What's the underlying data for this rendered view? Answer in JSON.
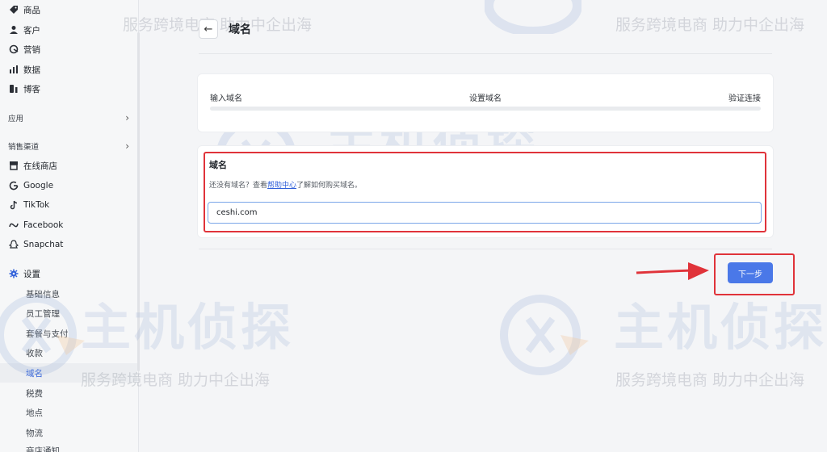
{
  "sidebar": {
    "items": [
      {
        "label": "商品",
        "icon": "tag-icon"
      },
      {
        "label": "客户",
        "icon": "user-icon"
      },
      {
        "label": "营销",
        "icon": "marketing-icon"
      },
      {
        "label": "数据",
        "icon": "bar-chart-icon"
      },
      {
        "label": "博客",
        "icon": "blog-icon"
      }
    ],
    "section_apps": "应用",
    "section_channels": "销售渠道",
    "channels": [
      {
        "label": "在线商店",
        "icon": "store-icon"
      },
      {
        "label": "Google",
        "icon": "google-icon"
      },
      {
        "label": "TikTok",
        "icon": "tiktok-icon"
      },
      {
        "label": "Facebook",
        "icon": "meta-icon"
      },
      {
        "label": "Snapchat",
        "icon": "snapchat-icon"
      }
    ],
    "settings": {
      "label": "设置",
      "icon": "gear-icon"
    },
    "settings_items": [
      "基础信息",
      "员工管理",
      "套餐与支付",
      "收款",
      "域名",
      "税费",
      "地点",
      "物流",
      "商店通知"
    ],
    "active_settings_item": "域名"
  },
  "header": {
    "back_icon": "arrow-left-icon",
    "title": "域名"
  },
  "steps": [
    "输入域名",
    "设置域名",
    "验证连接"
  ],
  "domain_form": {
    "title": "域名",
    "help_prefix": "还没有域名？查看",
    "help_link": "帮助中心",
    "help_suffix": "了解如何购买域名。",
    "value": "ceshi.com"
  },
  "next_button": "下一步",
  "watermark": {
    "slogan": "服务跨境电商 助力中企出海",
    "brand": "主机侦探"
  },
  "colors": {
    "accent": "#4a78e8",
    "highlight_red": "#e0333a",
    "link": "#2f5fd9"
  }
}
